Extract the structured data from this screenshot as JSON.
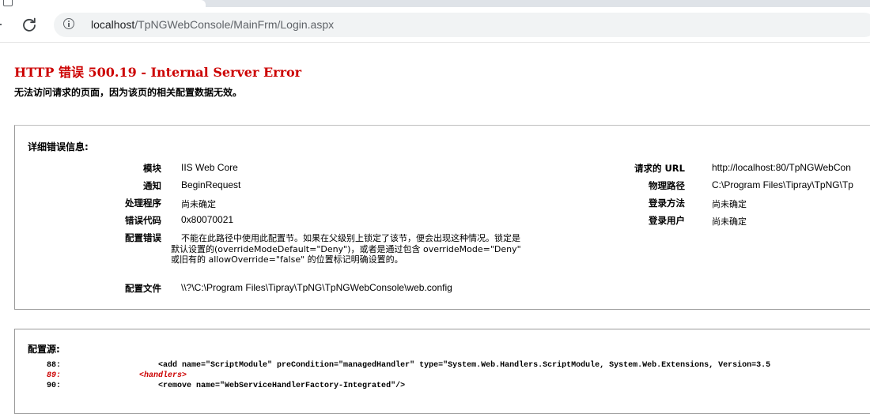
{
  "browser": {
    "url_host": "localhost",
    "url_path": "/TpNGWebConsole/MainFrm/Login.aspx"
  },
  "error": {
    "title": "HTTP 错误 500.19 - Internal Server Error",
    "subtitle": "无法访问请求的页面，因为该页的相关配置数据无效。"
  },
  "details": {
    "heading": "详细错误信息:",
    "left": [
      {
        "label": "模块",
        "value": "IIS Web Core"
      },
      {
        "label": "通知",
        "value": "BeginRequest"
      },
      {
        "label": "处理程序",
        "value": "尚未确定"
      },
      {
        "label": "错误代码",
        "value": "0x80070021"
      },
      {
        "label": "配置错误",
        "value": "不能在此路径中使用此配置节。如果在父级别上锁定了该节，便会出现这种情况。锁定是默认设置的(overrideModeDefault=\"Deny\")，或者是通过包含 overrideMode=\"Deny\" 或旧有的 allowOverride=\"false\" 的位置标记明确设置的。"
      },
      {
        "label": "配置文件",
        "value": "\\\\?\\C:\\Program Files\\Tipray\\TpNG\\TpNGWebConsole\\web.config"
      }
    ],
    "right": [
      {
        "label": "请求的 URL",
        "value": "http://localhost:80/TpNGWebCon"
      },
      {
        "label": "物理路径",
        "value": "C:\\Program Files\\Tipray\\TpNG\\Tp"
      },
      {
        "label": "登录方法",
        "value": "尚未确定"
      },
      {
        "label": "登录用户",
        "value": "尚未确定"
      }
    ]
  },
  "config_source": {
    "heading": "配置源:",
    "lines": [
      {
        "num": "88:",
        "code": "                <add name=\"ScriptModule\" preCondition=\"managedHandler\" type=\"System.Web.Handlers.ScriptModule, System.Web.Extensions, Version=3.5"
      },
      {
        "num": "89:",
        "code": "            <handlers>"
      },
      {
        "num": "90:",
        "code": "                <remove name=\"WebServiceHandlerFactory-Integrated\"/>"
      }
    ]
  },
  "colors": {
    "error_red": "#cc0000",
    "border_gray": "#9a9a9a",
    "omnibox_bg": "#f1f3f4"
  },
  "icons": [
    "reload-icon",
    "info-icon"
  ]
}
